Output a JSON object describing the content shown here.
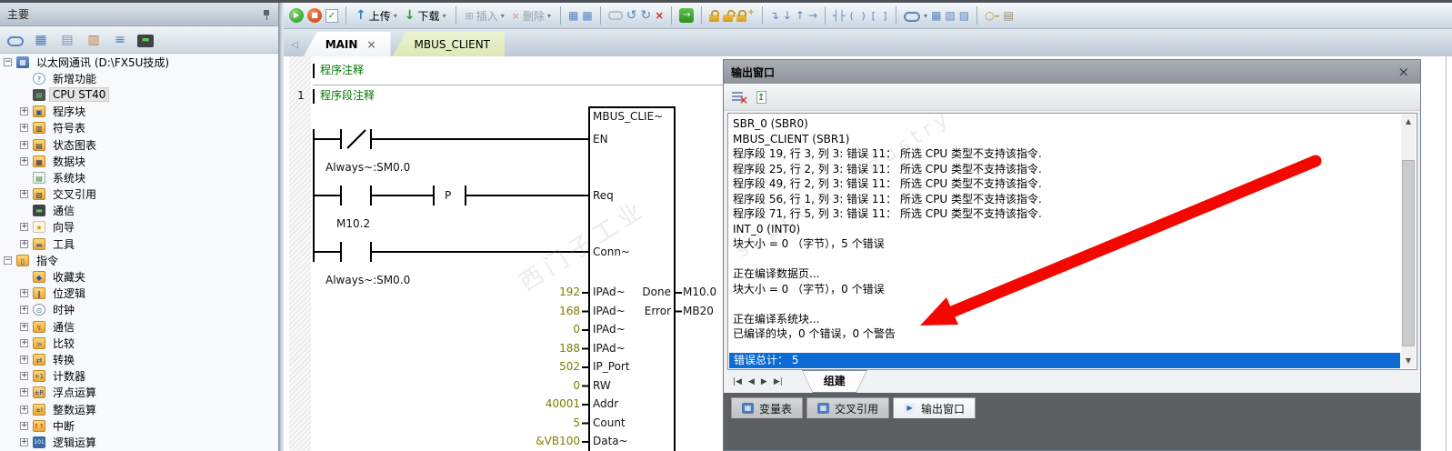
{
  "sidebar": {
    "title": "主要",
    "toolbar_icons": [
      "tag-icon",
      "grid-icon",
      "document-icon",
      "chart-icon",
      "list-icon",
      "monitor-icon"
    ],
    "tree": [
      {
        "label": "以太网通讯 (D:\\FX5U技成)",
        "icon": "project-icon",
        "expander": "minus",
        "level": 0
      },
      {
        "label": "新增功能",
        "icon": "whats-new-icon",
        "expander": "none",
        "level": 1
      },
      {
        "label": "CPU ST40",
        "icon": "cpu-icon",
        "expander": "none",
        "level": 1,
        "selected": true
      },
      {
        "label": "程序块",
        "icon": "program-block-icon",
        "expander": "plus",
        "level": 1
      },
      {
        "label": "符号表",
        "icon": "symbol-table-icon",
        "expander": "plus",
        "level": 1
      },
      {
        "label": "状态图表",
        "icon": "status-chart-icon",
        "expander": "plus",
        "level": 1
      },
      {
        "label": "数据块",
        "icon": "data-block-icon",
        "expander": "plus",
        "level": 1
      },
      {
        "label": "系统块",
        "icon": "system-block-icon",
        "expander": "none",
        "level": 1
      },
      {
        "label": "交叉引用",
        "icon": "cross-ref-icon",
        "expander": "plus",
        "level": 1
      },
      {
        "label": "通信",
        "icon": "communication-icon",
        "expander": "none",
        "level": 1
      },
      {
        "label": "向导",
        "icon": "wizard-icon",
        "expander": "plus",
        "level": 1
      },
      {
        "label": "工具",
        "icon": "tools-icon",
        "expander": "plus",
        "level": 1
      },
      {
        "label": "指令",
        "icon": "instructions-icon",
        "expander": "minus",
        "level": 0
      },
      {
        "label": "收藏夹",
        "icon": "favorites-icon",
        "expander": "none",
        "level": 1
      },
      {
        "label": "位逻辑",
        "icon": "bit-logic-icon",
        "expander": "plus",
        "level": 1
      },
      {
        "label": "时钟",
        "icon": "clock-icon",
        "expander": "plus",
        "level": 1
      },
      {
        "label": "通信",
        "icon": "comm-folder-icon",
        "expander": "plus",
        "level": 1
      },
      {
        "label": "比较",
        "icon": "compare-icon",
        "expander": "plus",
        "level": 1
      },
      {
        "label": "转换",
        "icon": "convert-icon",
        "expander": "plus",
        "level": 1
      },
      {
        "label": "计数器",
        "icon": "counter-icon",
        "expander": "plus",
        "level": 1
      },
      {
        "label": "浮点运算",
        "icon": "float-math-icon",
        "expander": "plus",
        "level": 1
      },
      {
        "label": "整数运算",
        "icon": "int-math-icon",
        "expander": "plus",
        "level": 1
      },
      {
        "label": "中断",
        "icon": "interrupt-icon",
        "expander": "plus",
        "level": 1
      },
      {
        "label": "逻辑运算",
        "icon": "logic-icon",
        "expander": "plus",
        "level": 1
      }
    ]
  },
  "toolbar": {
    "upload": "上传",
    "download": "下载",
    "insert": "插入",
    "delete": "删除"
  },
  "tabs": [
    {
      "label": "MAIN",
      "close": "×",
      "active": true
    },
    {
      "label": "MBUS_CLIENT",
      "active": false
    }
  ],
  "editor": {
    "program_comment": "程序注释",
    "network_number": "1",
    "network_comment": "程序段注释"
  },
  "ladder": {
    "rung1_contact": "Always~:SM0.0",
    "rung2_contact": "M10.2",
    "edge_label": "P",
    "rung3_contact": "Always~:SM0.0",
    "block": {
      "name": "MBUS_CLIE~",
      "en_port": "EN",
      "req_port": "Req",
      "conn_port": "Conn~",
      "inputs": [
        {
          "value": "192",
          "port": "IPAd~"
        },
        {
          "value": "168",
          "port": "IPAd~"
        },
        {
          "value": "0",
          "port": "IPAd~"
        },
        {
          "value": "188",
          "port": "IPAd~"
        },
        {
          "value": "502",
          "port": "IP_Port"
        },
        {
          "value": "0",
          "port": "RW"
        },
        {
          "value": "40001",
          "port": "Addr"
        },
        {
          "value": "5",
          "port": "Count"
        },
        {
          "value": "&VB100",
          "port": "Data~"
        }
      ],
      "outputs": [
        {
          "port": "Done",
          "value": "M10.0"
        },
        {
          "port": "Error",
          "value": "MB20"
        }
      ]
    }
  },
  "output_window": {
    "title": "输出窗口",
    "close": "×",
    "lines": [
      "SBR_0 (SBR0)",
      "MBUS_CLIENT (SBR1)",
      "程序段 19, 行 3, 列 3: 错误 11： 所选 CPU 类型不支持该指令.",
      "程序段 25, 行 2, 列 3: 错误 11： 所选 CPU 类型不支持该指令.",
      "程序段 49, 行 2, 列 3: 错误 11： 所选 CPU 类型不支持该指令.",
      "程序段 56, 行 1, 列 3: 错误 11： 所选 CPU 类型不支持该指令.",
      "程序段 71, 行 5, 列 3: 错误 11： 所选 CPU 类型不支持该指令.",
      "INT_0 (INT0)",
      "块大小 = 0 （字节），5 个错误",
      "",
      "正在编译数据页...",
      "块大小 = 0 （字节），0 个错误",
      "",
      "正在编译系统块...",
      "已编译的块，0 个错误，0 个警告"
    ],
    "selected_line": "错误总计： 5",
    "nav_tab": "组建",
    "dock_tabs": [
      {
        "label": "变量表",
        "icon": "variable-table-icon",
        "active": false
      },
      {
        "label": "交叉引用",
        "icon": "cross-reference-icon",
        "active": false
      },
      {
        "label": "输出窗口",
        "icon": "output-window-icon",
        "active": true
      }
    ]
  },
  "watermarks": [
    "西门子工业",
    "support industry"
  ],
  "colors": {
    "comment_green": "#007800",
    "value_olive": "#7d7d00",
    "selection_blue": "#0c6cd4",
    "arrow_red": "#f20800",
    "mbus_tab_bg": "#dde8b6"
  }
}
